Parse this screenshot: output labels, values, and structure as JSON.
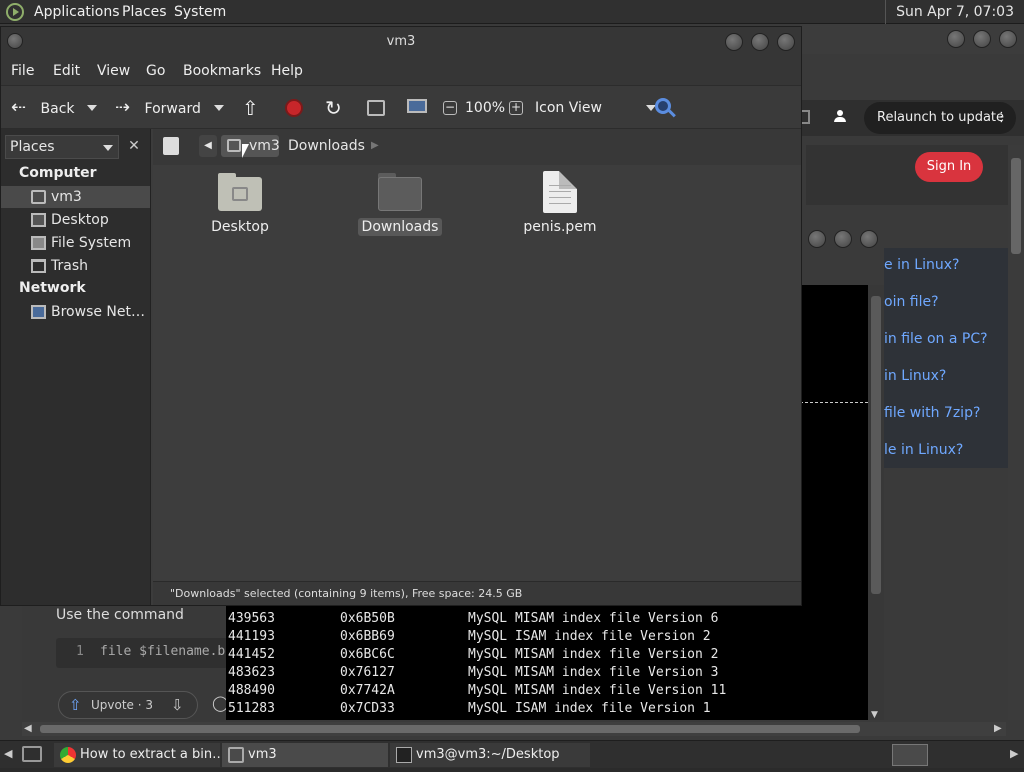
{
  "top_panel": {
    "menus": [
      "Applications",
      "Places",
      "System"
    ],
    "clock": "Sun Apr 7, 07:03"
  },
  "browser": {
    "relaunch_label": "Relaunch to update",
    "signin_label": "Sign In",
    "related_links": [
      "e in Linux?",
      "oin file?",
      "in file on a PC?",
      "in Linux?",
      "file with 7zip?",
      "le in Linux?"
    ],
    "use_command_text": "Use the command",
    "code_line_number": "1",
    "code_text": "file $filename.b",
    "upvote_label": "Upvote · 3"
  },
  "terminal": {
    "rows": [
      {
        "decimal": "439563",
        "hex": "0x6B50B",
        "description": "MySQL MISAM index file Version 6"
      },
      {
        "decimal": "441193",
        "hex": "0x6BB69",
        "description": "MySQL ISAM index file Version 2"
      },
      {
        "decimal": "441452",
        "hex": "0x6BC6C",
        "description": "MySQL MISAM index file Version 2"
      },
      {
        "decimal": "483623",
        "hex": "0x76127",
        "description": "MySQL MISAM index file Version 3"
      },
      {
        "decimal": "488490",
        "hex": "0x7742A",
        "description": "MySQL MISAM index file Version 11"
      },
      {
        "decimal": "511283",
        "hex": "0x7CD33",
        "description": "MySQL ISAM index file Version 1"
      }
    ]
  },
  "file_manager": {
    "title": "vm3",
    "menus": [
      "File",
      "Edit",
      "View",
      "Go",
      "Bookmarks",
      "Help"
    ],
    "toolbar": {
      "back": "Back",
      "forward": "Forward",
      "zoom": "100%",
      "view_mode": "Icon View"
    },
    "sidebar": {
      "select_label": "Places",
      "close_glyph": "✕",
      "sections": [
        {
          "heading": "Computer",
          "items": [
            {
              "label": "vm3",
              "icon": "home-icon",
              "selected": true
            },
            {
              "label": "Desktop",
              "icon": "desktop-icon",
              "selected": false
            },
            {
              "label": "File System",
              "icon": "drive-icon",
              "selected": false
            },
            {
              "label": "Trash",
              "icon": "trash-icon",
              "selected": false
            }
          ]
        },
        {
          "heading": "Network",
          "items": [
            {
              "label": "Browse Net…",
              "icon": "network-icon",
              "selected": false
            }
          ]
        }
      ]
    },
    "pathbar": [
      "vm3",
      "Downloads"
    ],
    "files": [
      {
        "name": "Desktop",
        "type": "folder-desktop",
        "selected": false
      },
      {
        "name": "Downloads",
        "type": "folder",
        "selected": true
      },
      {
        "name": "penis.pem",
        "type": "text-file",
        "selected": false
      }
    ],
    "status": "\"Downloads\" selected (containing 9 items), Free space: 24.5 GB"
  },
  "taskbar": {
    "tasks": [
      {
        "label": "How to extract a bin…",
        "icon": "chrome-icon"
      },
      {
        "label": "vm3",
        "icon": "folder-icon"
      },
      {
        "label": "vm3@vm3:~/Desktop",
        "icon": "terminal-icon"
      }
    ]
  },
  "colors": {
    "signin": "#d9343e",
    "link": "#6fa8ff",
    "panel": "#303030"
  }
}
